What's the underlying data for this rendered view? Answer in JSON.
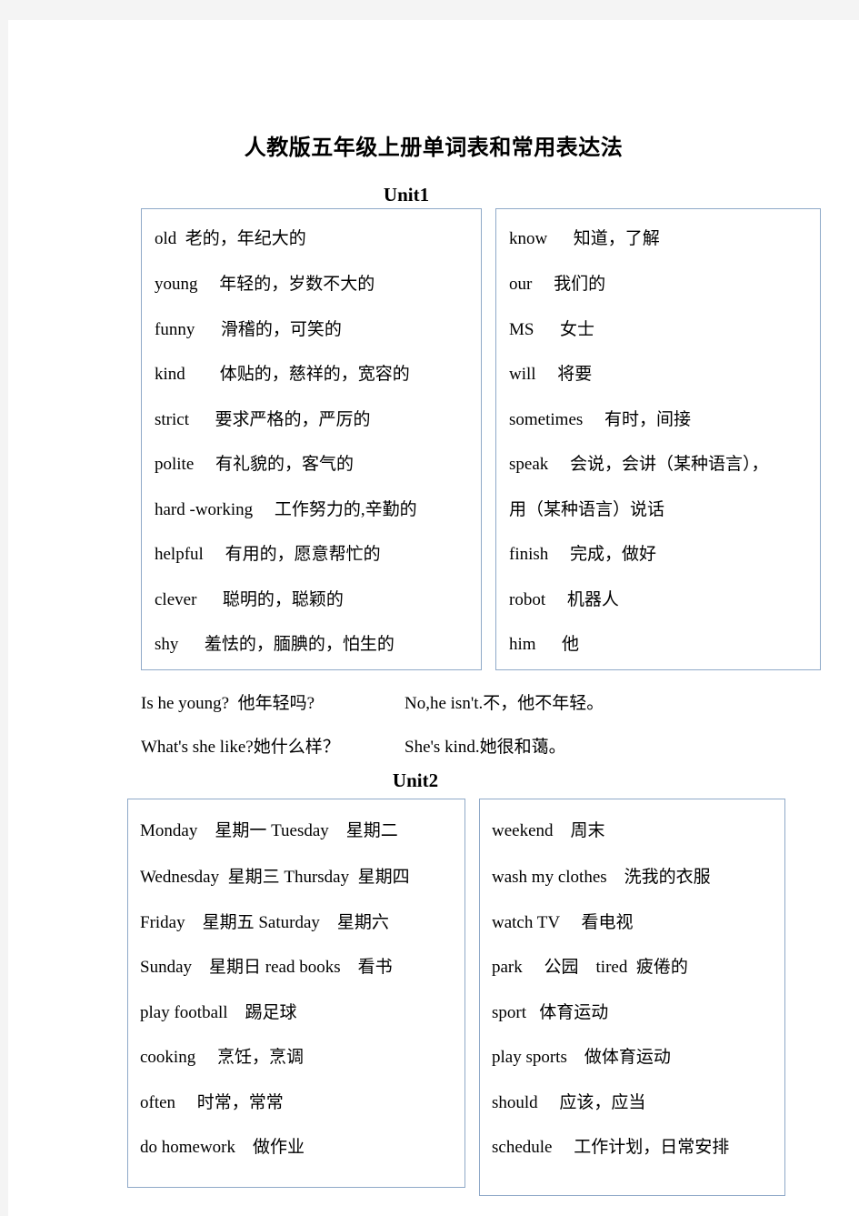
{
  "document": {
    "title": "人教版五年级上册单词表和常用表达法"
  },
  "units": [
    {
      "heading": "Unit1",
      "left_column": [
        "old  老的，年纪大的",
        "young     年轻的，岁数不大的",
        "funny      滑稽的，可笑的",
        "kind        体贴的，慈祥的，宽容的",
        "strict      要求严格的，严厉的",
        "polite     有礼貌的，客气的",
        "hard -working     工作努力的,辛勤的",
        "helpful     有用的，愿意帮忙的",
        "clever      聪明的，聪颖的",
        "shy      羞怯的，腼腆的，怕生的"
      ],
      "right_column": [
        "know      知道，了解",
        "our     我们的",
        "MS      女士",
        "will     将要",
        "sometimes     有时，间接",
        "speak     会说，会讲（某种语言），",
        "用（某种语言）说话",
        "finish     完成，做好",
        "robot     机器人",
        "him      他"
      ],
      "sentences": [
        {
          "question": "Is he young?  他年轻吗?",
          "answer": "No,he isn't.不，他不年轻。"
        },
        {
          "question": "What's she like?她什么样？",
          "answer": "She's kind.她很和蔼。"
        }
      ]
    },
    {
      "heading": "Unit2",
      "left_column": [
        "Monday    星期一 Tuesday    星期二",
        "Wednesday  星期三 Thursday  星期四",
        "Friday    星期五 Saturday    星期六",
        "Sunday    星期日 read books    看书",
        "play football    踢足球",
        "cooking     烹饪，烹调",
        "often     时常，常常",
        "do homework    做作业"
      ],
      "right_column": [
        "weekend    周末",
        "wash my clothes    洗我的衣服",
        "watch TV     看电视",
        "park     公园    tired  疲倦的",
        "sport   体育运动",
        "play sports    做体育运动",
        "should     应该，应当",
        "schedule     工作计划，日常安排"
      ],
      "sentences": []
    }
  ],
  "colors": {
    "table_border": "#8fa9c8",
    "page_background": "#ffffff",
    "canvas_background": "#f4f4f4",
    "text": "#000000"
  }
}
